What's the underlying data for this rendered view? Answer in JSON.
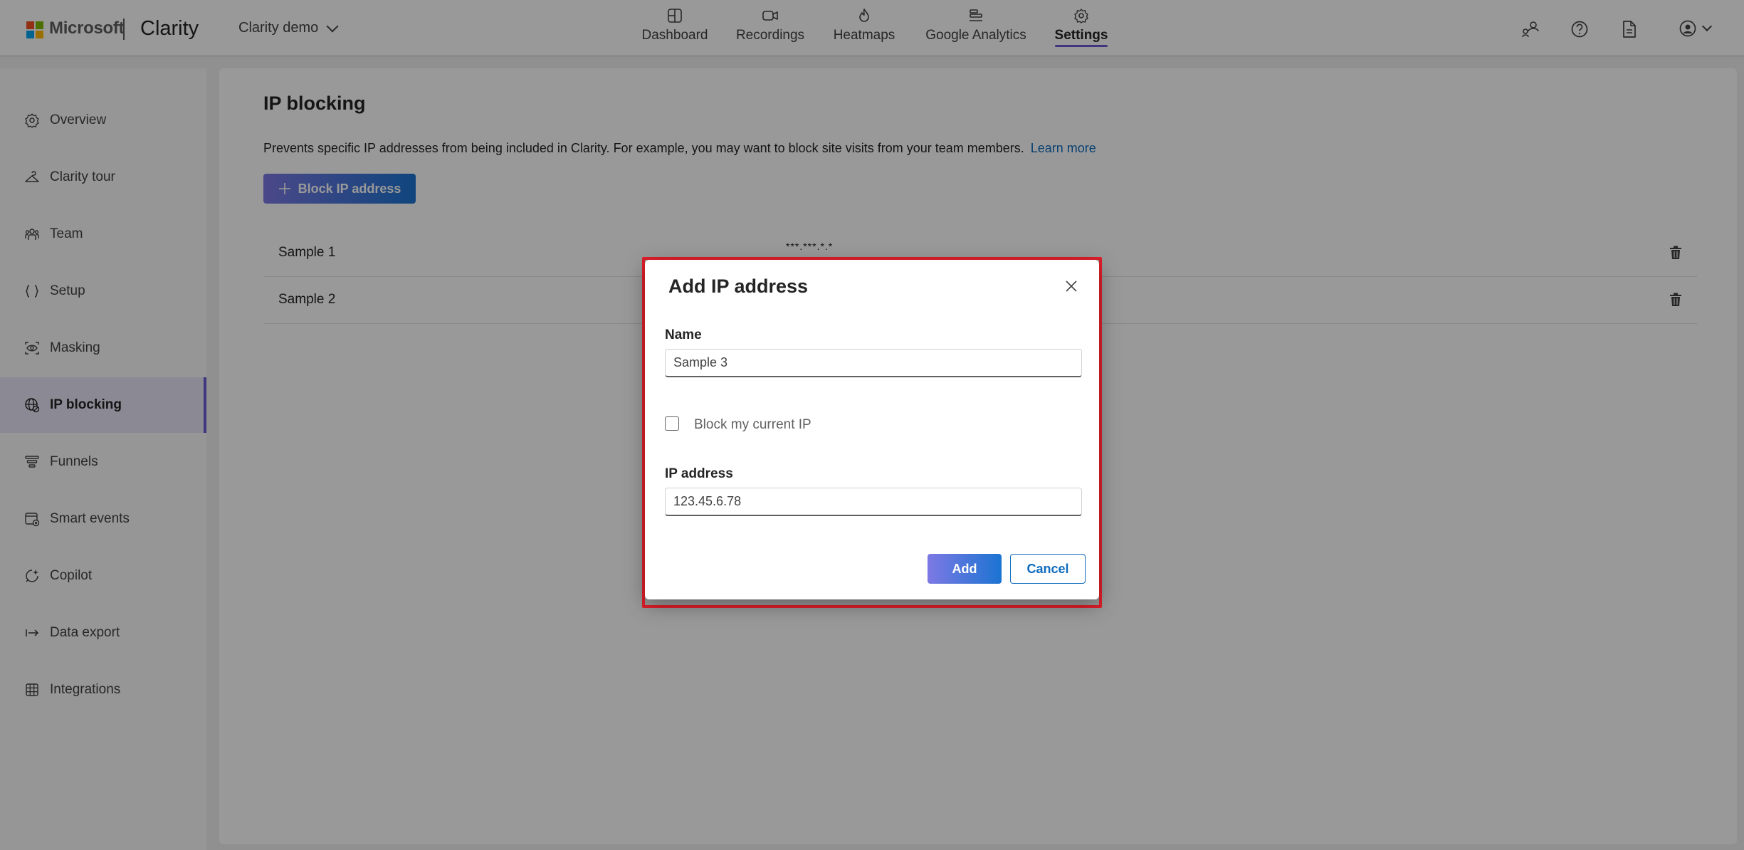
{
  "header": {
    "brand": "Microsoft",
    "app": "Clarity",
    "project": "Clarity demo",
    "nav": [
      {
        "label": "Dashboard",
        "icon": "dashboard-icon"
      },
      {
        "label": "Recordings",
        "icon": "video-camera-icon"
      },
      {
        "label": "Heatmaps",
        "icon": "flame-icon"
      },
      {
        "label": "Google Analytics",
        "icon": "analytics-bars-icon"
      },
      {
        "label": "Settings",
        "icon": "gear-icon",
        "active": true
      }
    ],
    "right_icons": [
      "people-connect-icon",
      "help-circle-icon",
      "document-icon",
      "account-avatar-icon"
    ]
  },
  "sidebar": {
    "items": [
      {
        "label": "Overview",
        "icon": "gear-icon"
      },
      {
        "label": "Clarity tour",
        "icon": "hanger-icon"
      },
      {
        "label": "Team",
        "icon": "team-icon"
      },
      {
        "label": "Setup",
        "icon": "braces-icon"
      },
      {
        "label": "Masking",
        "icon": "eye-scan-icon"
      },
      {
        "label": "IP blocking",
        "icon": "globe-block-icon",
        "active": true
      },
      {
        "label": "Funnels",
        "icon": "funnel-icon"
      },
      {
        "label": "Smart events",
        "icon": "smart-events-icon"
      },
      {
        "label": "Copilot",
        "icon": "copilot-icon"
      },
      {
        "label": "Data export",
        "icon": "export-arrow-icon"
      },
      {
        "label": "Integrations",
        "icon": "grid-icon"
      }
    ]
  },
  "main": {
    "title": "IP blocking",
    "description": "Prevents specific IP addresses from being included in Clarity. For example, you may want to block site visits from your team members.",
    "learn_more": "Learn more",
    "block_button": "Block IP address",
    "rows": [
      {
        "name": "Sample 1",
        "ip": "***.***.*.*"
      },
      {
        "name": "Sample 2",
        "ip": ""
      }
    ]
  },
  "dialog": {
    "title": "Add IP address",
    "name_label": "Name",
    "name_value": "Sample 3",
    "checkbox_label": "Block my current IP",
    "checkbox_checked": false,
    "ip_label": "IP address",
    "ip_value": "123.45.6.78",
    "add_button": "Add",
    "cancel_button": "Cancel"
  },
  "colors": {
    "accent": "#6b5bd6",
    "button_gradient_start": "#7d79e4",
    "button_gradient_end": "#1b74d2",
    "link": "#0f6cbd",
    "highlight_border": "#e01f2b"
  }
}
